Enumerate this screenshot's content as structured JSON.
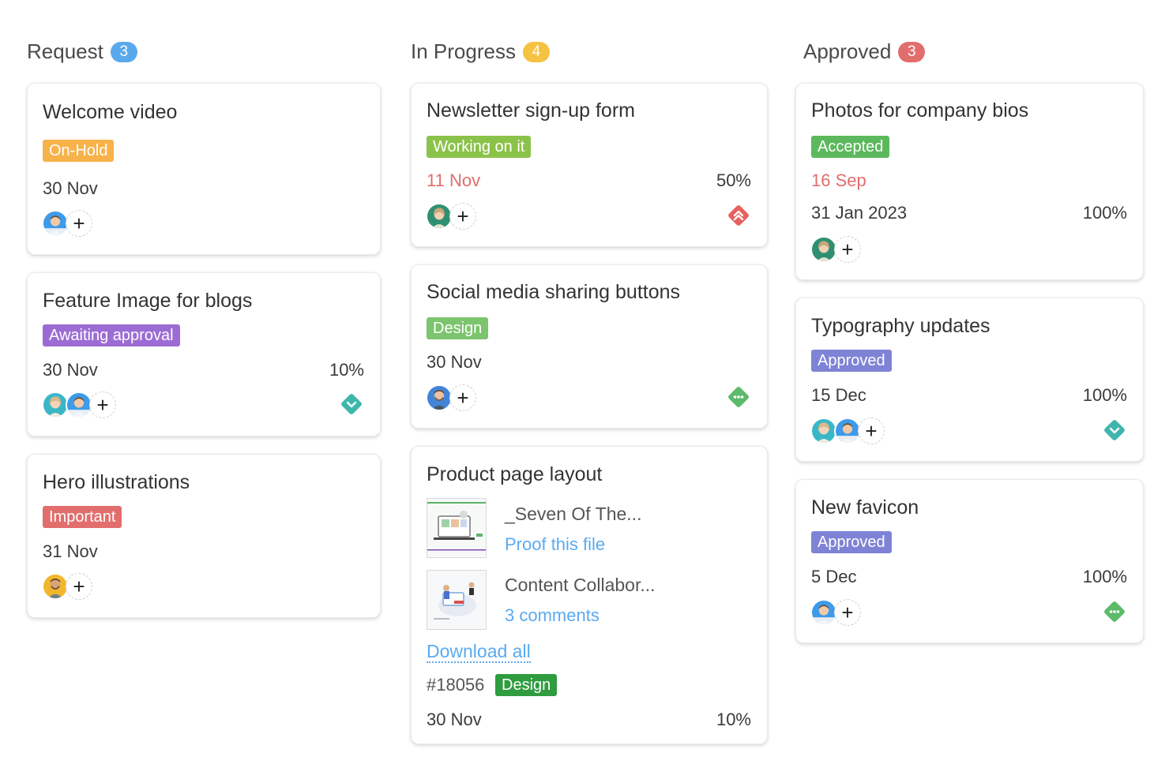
{
  "colors": {
    "request_count": "#5aa9ec",
    "in_progress_count": "#f5c242",
    "approved_count": "#e26d6d",
    "tag_on_hold": "#f7b24a",
    "tag_awaiting": "#9c6cd4",
    "tag_important": "#e26d6d",
    "tag_working": "#8bc34a",
    "tag_design_light": "#7cc46d",
    "tag_accepted": "#5cb85c",
    "tag_approved": "#7e83d6",
    "tag_design_dark": "#2e9c3f",
    "date_overdue": "#e26d6d",
    "link": "#5aaaf0",
    "priority_high": "#e8605f",
    "priority_low": "#3fb6ad",
    "priority_medium": "#5dba6a"
  },
  "columns": {
    "request": {
      "title": "Request",
      "count": "3",
      "cards": [
        {
          "title": "Welcome video",
          "tag": "On-Hold",
          "date": "30 Nov"
        },
        {
          "title": "Feature Image for blogs",
          "tag": "Awaiting approval",
          "date": "30 Nov",
          "progress": "10%",
          "priority_icon": "chevron-down-diamond-icon"
        },
        {
          "title": "Hero illustrations",
          "tag": "Important",
          "date": "31 Nov"
        }
      ]
    },
    "in_progress": {
      "title": "In Progress",
      "count": "4",
      "cards": [
        {
          "title": "Newsletter sign-up form",
          "tag": "Working on it",
          "date": "11 Nov",
          "progress": "50%",
          "priority_icon": "double-chevron-up-diamond-icon"
        },
        {
          "title": "Social media sharing buttons",
          "tag": "Design",
          "date": "30 Nov",
          "priority_icon": "dots-diamond-icon"
        },
        {
          "title": "Product page layout",
          "files": [
            {
              "name": "_Seven Of The...",
              "link": "Proof this file"
            },
            {
              "name": "Content Collabor...",
              "link": "3 comments"
            }
          ],
          "download_all": "Download all",
          "task_id": "#18056",
          "tag": "Design",
          "date": "30 Nov",
          "progress": "10%"
        }
      ]
    },
    "approved": {
      "title": "Approved",
      "count": "3",
      "cards": [
        {
          "title": "Photos for company bios",
          "tag": "Accepted",
          "start_date": "16 Sep",
          "date": "31 Jan 2023",
          "progress": "100%"
        },
        {
          "title": "Typography updates",
          "tag": "Approved",
          "date": "15 Dec",
          "progress": "100%",
          "priority_icon": "chevron-down-diamond-icon"
        },
        {
          "title": "New favicon",
          "tag": "Approved",
          "date": "5 Dec",
          "progress": "100%",
          "priority_icon": "dots-diamond-icon"
        }
      ]
    }
  },
  "add_member_label": "+"
}
